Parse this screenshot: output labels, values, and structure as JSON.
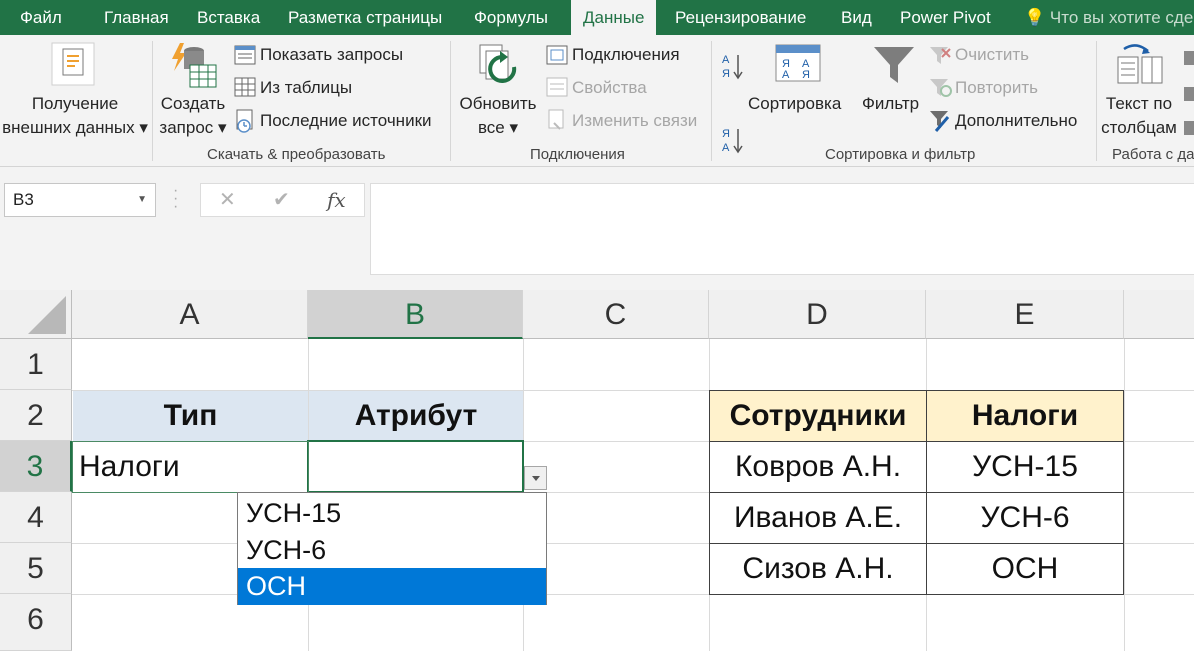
{
  "tabs": [
    "Файл",
    "Главная",
    "Вставка",
    "Разметка страницы",
    "Формулы",
    "Данные",
    "Рецензирование",
    "Вид",
    "Power Pivot",
    "Что вы хотите сде"
  ],
  "active_tab": "Данные",
  "ribbon": {
    "get_data": [
      "Получение",
      "внешних данных"
    ],
    "new_query": [
      "Создать",
      "запрос"
    ],
    "show_queries": "Показать запросы",
    "from_table": "Из таблицы",
    "recent_sources": "Последние источники",
    "group_get_transform": "Скачать & преобразовать",
    "refresh_all": [
      "Обновить",
      "все"
    ],
    "connections": "Подключения",
    "properties": "Свойства",
    "edit_links": "Изменить связи",
    "group_connections": "Подключения",
    "sort": "Сортировка",
    "filter": "Фильтр",
    "clear": "Очистить",
    "reapply": "Повторить",
    "advanced": "Дополнительно",
    "group_sort_filter": "Сортировка и фильтр",
    "text_to_columns": [
      "Текст по",
      "столбцам"
    ],
    "group_data_tools": "Работа с да",
    "sort_az": "А\nЯ",
    "sort_za": "Я\nА"
  },
  "formula_bar": {
    "name_box": "B3",
    "cancel": "✕",
    "enter": "✔",
    "fx": "fx",
    "formula": ""
  },
  "columns": [
    "A",
    "B",
    "C",
    "D",
    "E"
  ],
  "selected_column": "B",
  "rows": [
    "1",
    "2",
    "3",
    "4",
    "5",
    "6"
  ],
  "selected_row": "3",
  "cells": {
    "A2": "Тип",
    "B2": "Атрибут",
    "A3": "Налоги",
    "B3": "",
    "D2": "Сотрудники",
    "E2": "Налоги",
    "D3": "Ковров А.Н.",
    "E3": "УСН-15",
    "D4": "Иванов А.Е.",
    "E4": "УСН-6",
    "D5": "Сизов А.Н.",
    "E5": "ОСН"
  },
  "dropdown": {
    "options": [
      "УСН-15",
      "УСН-6",
      "ОСН"
    ],
    "highlighted": "ОСН"
  },
  "colors": {
    "excel_green": "#217346",
    "header_blue_fill": "#dce6f1",
    "header_yellow_fill": "#fff2cc",
    "dropdown_highlight": "#0078d7"
  }
}
